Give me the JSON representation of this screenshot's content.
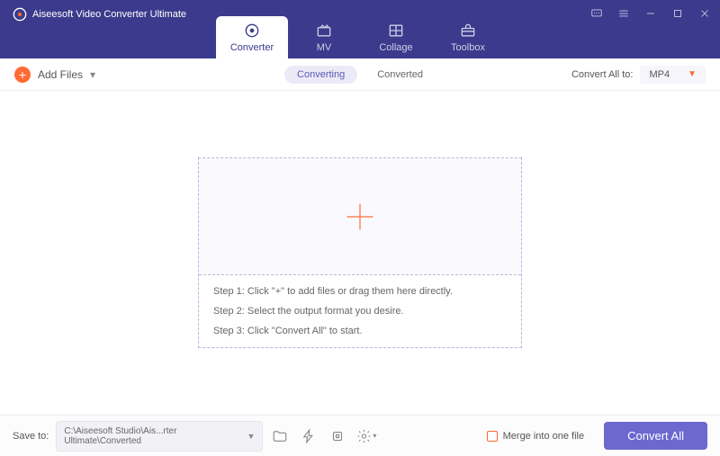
{
  "app": {
    "title": "Aiseesoft Video Converter Ultimate"
  },
  "tabs": {
    "converter": "Converter",
    "mv": "MV",
    "collage": "Collage",
    "toolbox": "Toolbox"
  },
  "toolbar": {
    "add_files": "Add Files",
    "converting": "Converting",
    "converted": "Converted",
    "convert_all_to": "Convert All to:",
    "format": "MP4"
  },
  "dropzone": {
    "step1": "Step 1: Click \"+\" to add files or drag them here directly.",
    "step2": "Step 2: Select the output format you desire.",
    "step3": "Step 3: Click \"Convert All\" to start."
  },
  "footer": {
    "save_to": "Save to:",
    "path": "C:\\Aiseesoft Studio\\Ais...rter Ultimate\\Converted",
    "merge": "Merge into one file",
    "convert_all": "Convert All"
  }
}
